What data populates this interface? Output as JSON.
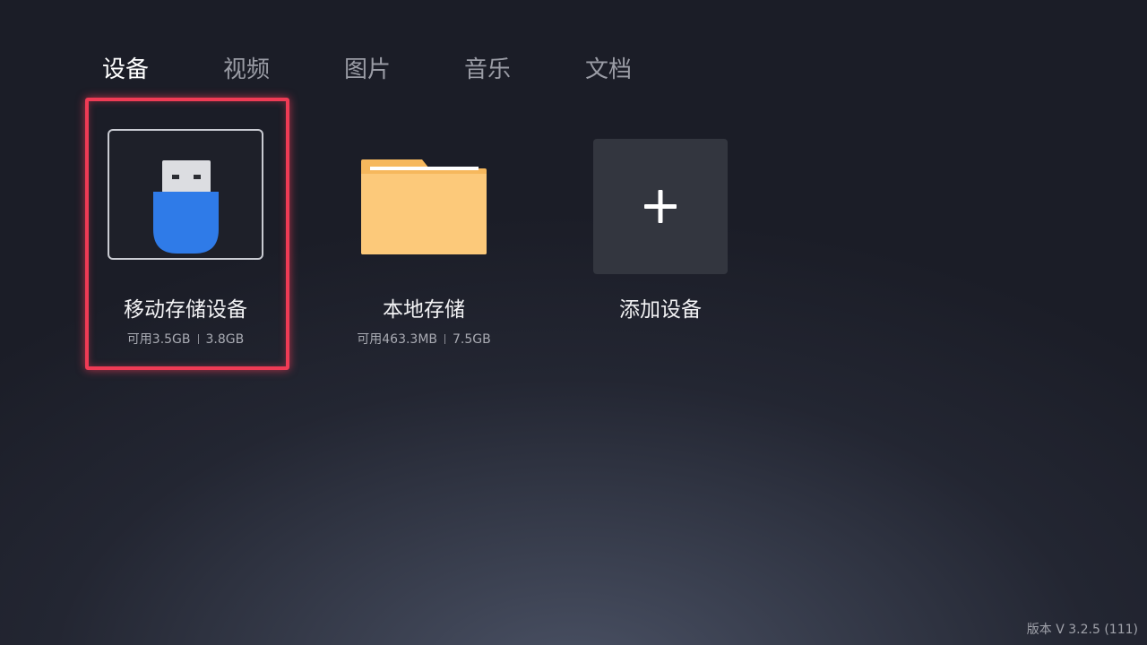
{
  "tabs": [
    {
      "label": "设备",
      "active": true
    },
    {
      "label": "视频",
      "active": false
    },
    {
      "label": "图片",
      "active": false
    },
    {
      "label": "音乐",
      "active": false
    },
    {
      "label": "文档",
      "active": false
    }
  ],
  "devices": [
    {
      "icon": "usb-drive-icon",
      "name": "移动存储设备",
      "available": "可用3.5GB",
      "total": "3.8GB",
      "focused": true
    },
    {
      "icon": "folder-icon",
      "name": "本地存储",
      "available": "可用463.3MB",
      "total": "7.5GB",
      "focused": false
    },
    {
      "icon": "plus-icon",
      "name": "添加设备"
    }
  ],
  "version": "版本 V 3.2.5 (111)",
  "colors": {
    "focus_border": "#ef3b55",
    "usb_body": "#2f7be8",
    "folder": "#fcc97a",
    "active_tab": "#ffffff",
    "inactive_tab": "#9a9ca5"
  }
}
